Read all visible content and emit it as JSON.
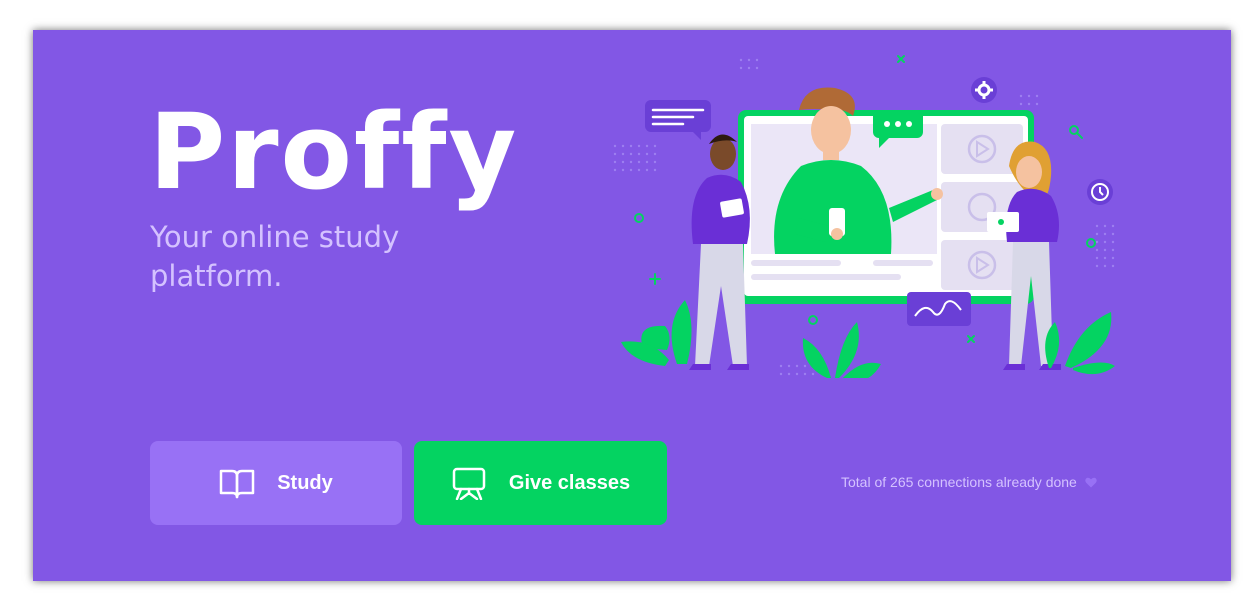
{
  "header": {
    "logo_text": "Proffy",
    "tagline": "Your online study platform."
  },
  "actions": {
    "study_label": "Study",
    "give_classes_label": "Give classes"
  },
  "footer": {
    "connections_text": "Total of 265 connections already done"
  },
  "icons": {
    "study": "book-open-icon",
    "give_classes": "presentation-board-icon",
    "heart": "heart-icon",
    "illustration": "online-class-illustration"
  },
  "colors": {
    "background": "#8257e5",
    "study_button": "#9871f5",
    "give_classes_button": "#04d361",
    "text_light": "#d4c2ff",
    "white": "#ffffff"
  }
}
